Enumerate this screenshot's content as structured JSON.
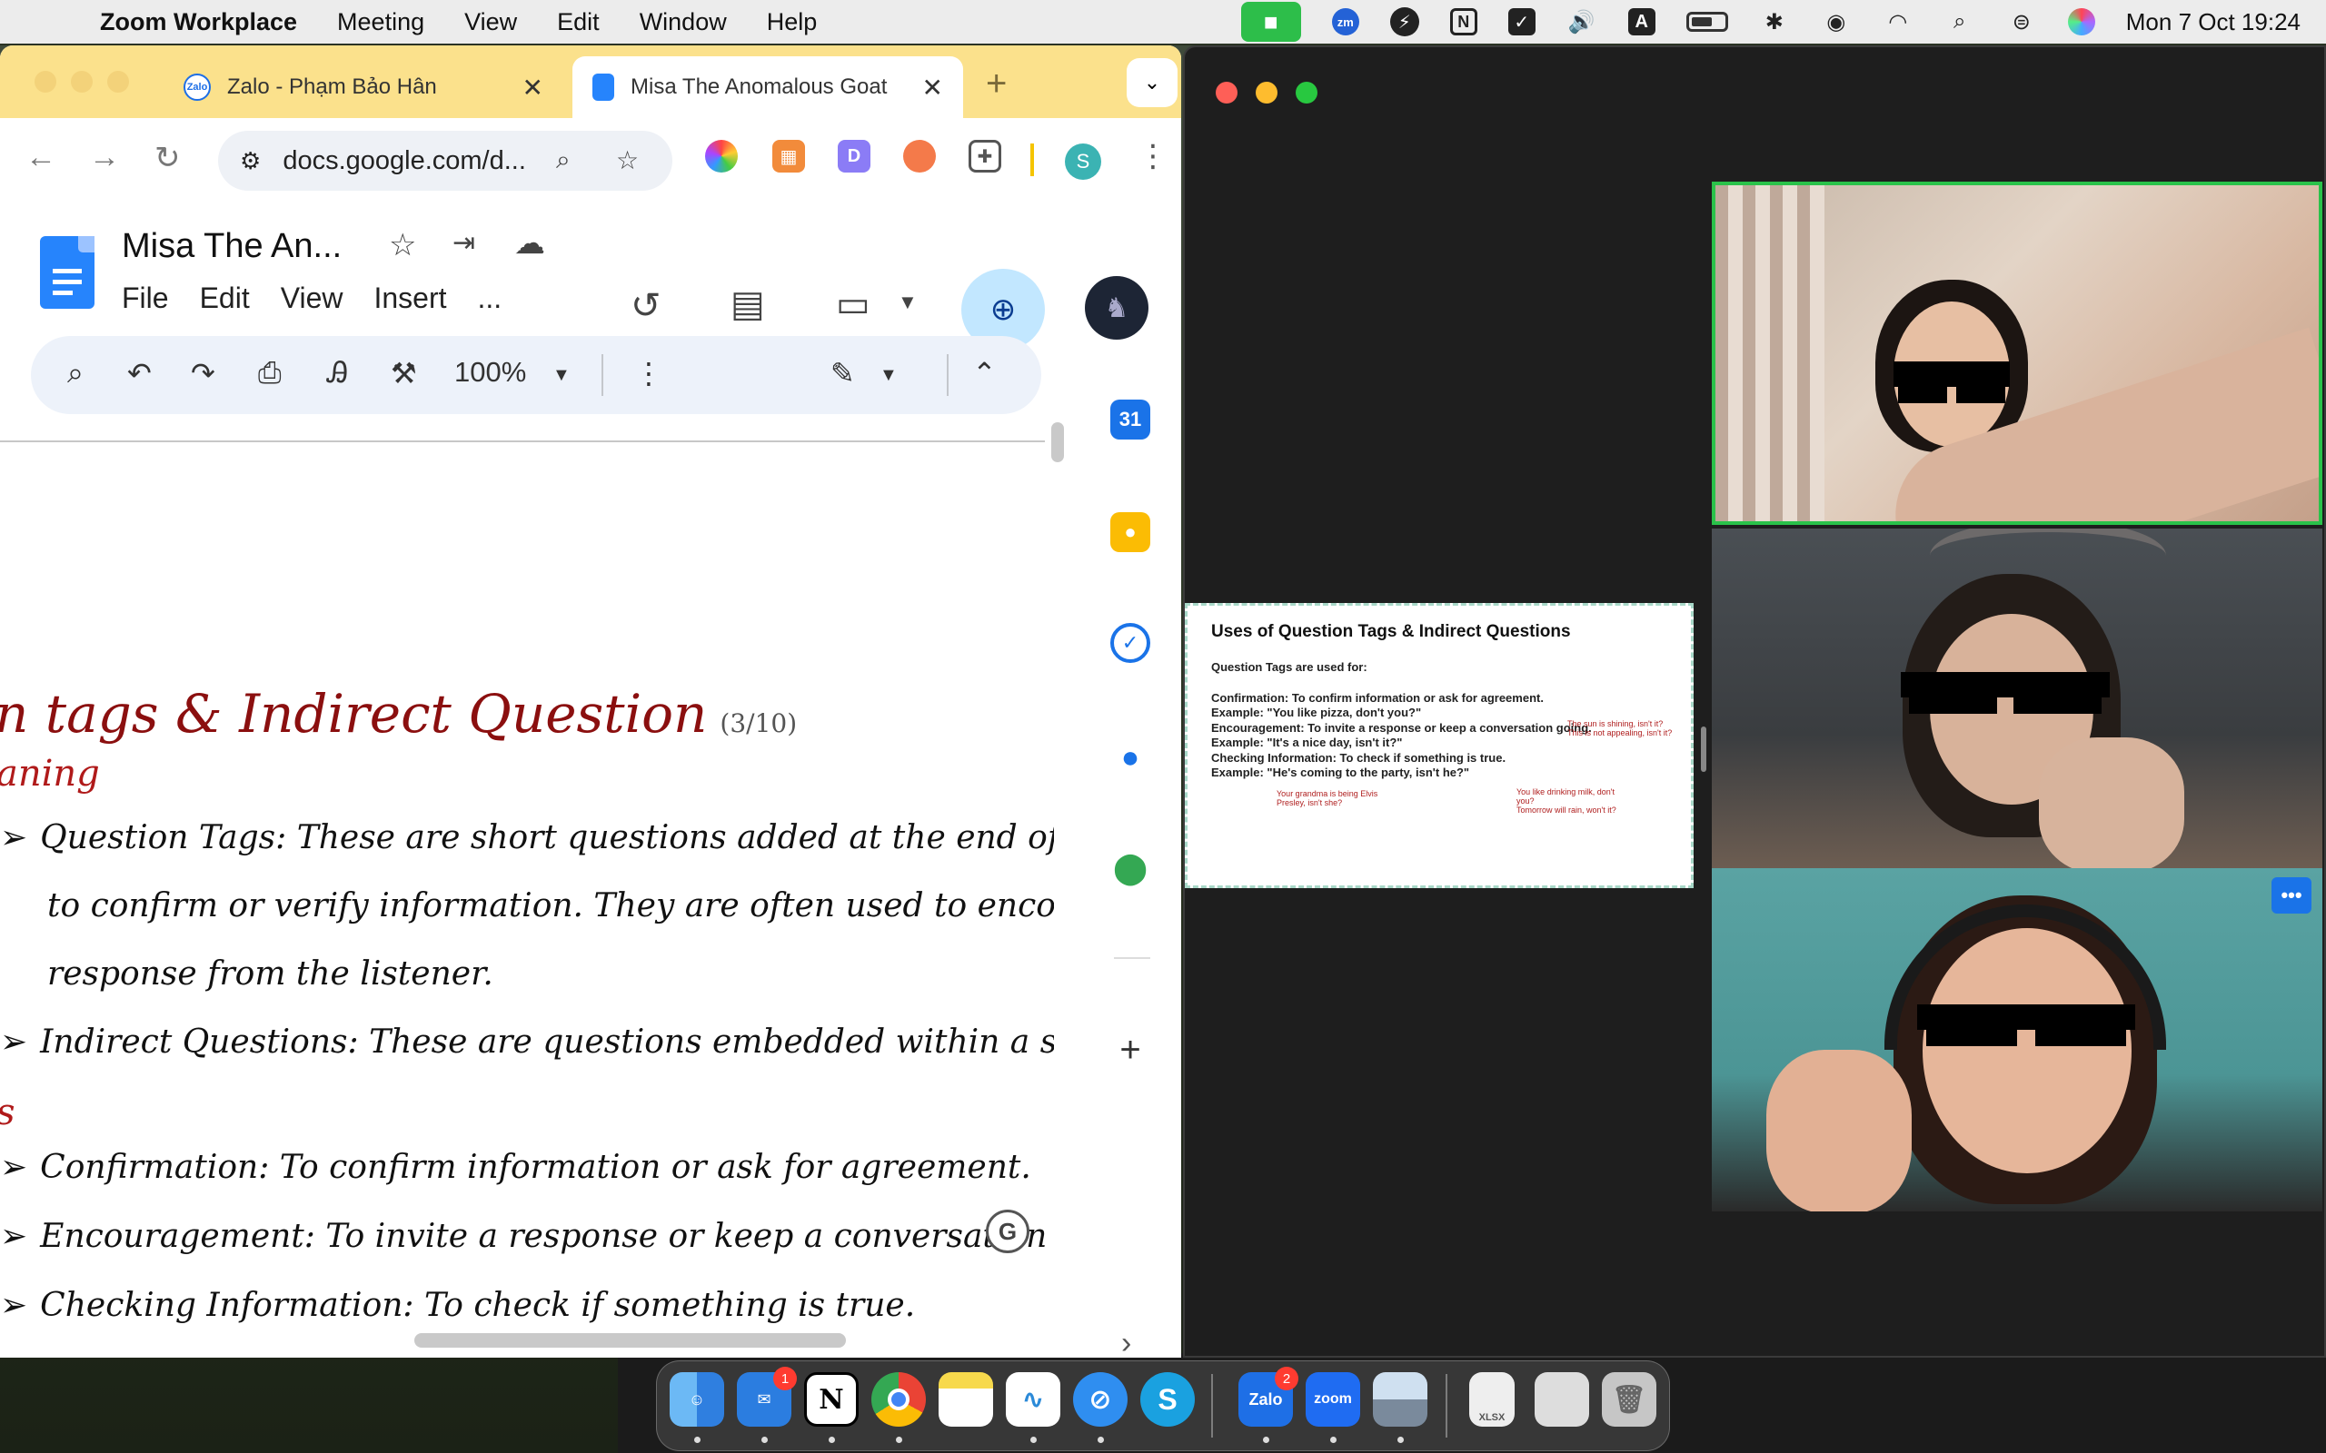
{
  "menubar": {
    "app_name": "Zoom Workplace",
    "menus": [
      "Meeting",
      "View",
      "Edit",
      "Window",
      "Help"
    ],
    "datetime": "Mon 7 Oct  19:24",
    "zm_label": "zm",
    "n_label": "N",
    "a_label": "A"
  },
  "chrome": {
    "tabs": [
      {
        "title": "Zalo - Phạm Bảo Hân",
        "favicon": "Zalo"
      },
      {
        "title": "Misa The Anomalous Goat"
      }
    ],
    "url": "docs.google.com/d...",
    "profile_initial": "S"
  },
  "docs": {
    "title": "Misa The An...",
    "menus": [
      "File",
      "Edit",
      "View",
      "Insert",
      "..."
    ],
    "zoom": "100%",
    "content": {
      "heading": "n tags & Indirect Question",
      "heading_count": "(3/10)",
      "subheading": "aning",
      "bullets": [
        "Question Tags: These are short questions added at the end of a statem",
        "to confirm or verify information. They are often used to encourage a",
        "response from the listener.",
        "Indirect Questions: These are questions embedded within a statement-"
      ],
      "subheading2": "s",
      "uses": [
        "Confirmation: To confirm information or ask for agreement.",
        "Encouragement: To invite a response or keep a conversation going.",
        "Checking Information: To check if something is true."
      ],
      "bullet_glyph": "➢"
    },
    "side_panel": {
      "calendar_day": "31"
    },
    "grammarly": "G"
  },
  "zoom_window": {
    "shared_slide": {
      "title": "Uses of Question Tags & Indirect Questions",
      "lines": [
        "Question Tags are used for:",
        "Confirmation: To confirm information or ask for agreement.",
        "     Example: \"You like pizza, don't you?\"",
        "Encouragement: To invite a response or keep a conversation going.",
        "     Example: \"It's a nice day, isn't it?\"",
        "Checking Information: To check if something is true.",
        "     Example: \"He's coming to the party, isn't he?\""
      ],
      "red_notes": [
        "Your grandma is being Elvis",
        "Presley, isn't she?",
        "You like drinking milk, don't",
        "you?",
        "Tomorrow will rain, won't it?",
        "The sun is shining, isn't it?",
        "This is not appealing, isn't it?"
      ]
    },
    "participants": 3,
    "more_button": "•••"
  },
  "dock": {
    "items": [
      {
        "name": "Finder",
        "color": "#3b8fe8"
      },
      {
        "name": "Mail",
        "color": "#2b7de0",
        "badge": "1"
      },
      {
        "name": "Notion",
        "color": "#ffffff",
        "label": "N"
      },
      {
        "name": "Chrome",
        "color": "#e8453c"
      },
      {
        "name": "Notes",
        "color": "#f7e07a"
      },
      {
        "name": "Freeform",
        "color": "#ffffff"
      },
      {
        "name": "Safari",
        "color": "#2f8ef0"
      },
      {
        "name": "Skype",
        "color": "#1aa1e0",
        "label": "S"
      },
      {
        "name": "Zalo",
        "color": "#1e6fe6",
        "label": "Zalo",
        "badge": "2"
      },
      {
        "name": "Zoom",
        "color": "#1f6cf2",
        "label": "zoom"
      },
      {
        "name": "Preview",
        "color": "#c9d7e6"
      },
      {
        "name": "XLSX file",
        "color": "#e8e8e8",
        "label": "XLSX"
      },
      {
        "name": "Stack",
        "color": "#dcdcdc"
      },
      {
        "name": "Trash",
        "color": "#bfbfbf"
      }
    ]
  }
}
